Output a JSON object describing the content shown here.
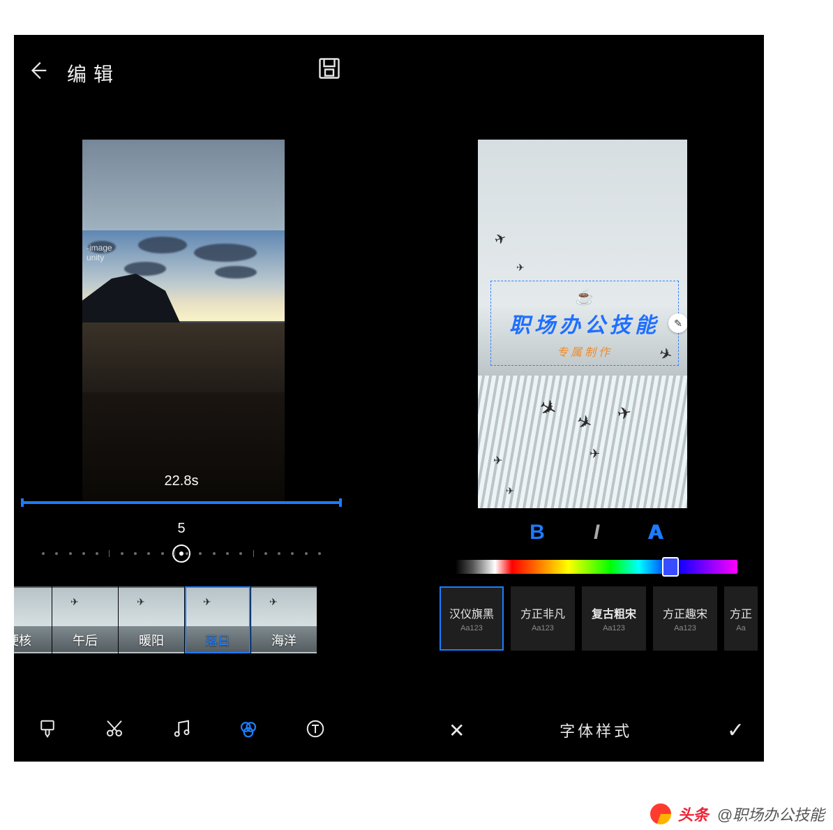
{
  "left": {
    "header_title": "编辑",
    "watermark_line1": "-image",
    "watermark_line2": "unity",
    "duration": "22.8s",
    "slider_value": "5",
    "filters": [
      {
        "label": "硬核"
      },
      {
        "label": "午后"
      },
      {
        "label": "暖阳"
      },
      {
        "label": "落日",
        "selected": true
      },
      {
        "label": "海洋"
      }
    ],
    "bottom_tools": [
      {
        "name": "brush",
        "active": false
      },
      {
        "name": "cut",
        "active": false
      },
      {
        "name": "music",
        "active": false
      },
      {
        "name": "filter",
        "active": true
      },
      {
        "name": "text",
        "active": false
      }
    ]
  },
  "right": {
    "title_main": "职场办公技能",
    "title_sub": "专属制作",
    "panel_label": "字体样式",
    "color_handle_percent": 78,
    "fonts": [
      {
        "name": "汉仪旗黑",
        "sample": "Aa123",
        "selected": true
      },
      {
        "name": "方正非凡",
        "sample": "Aa123"
      },
      {
        "name": "复古粗宋",
        "sample": "Aa123"
      },
      {
        "name": "方正趣宋",
        "sample": "Aa123"
      },
      {
        "name": "方正",
        "sample": "Aa"
      }
    ]
  },
  "page_watermark": {
    "brand": "头条",
    "author": "@职场办公技能"
  }
}
